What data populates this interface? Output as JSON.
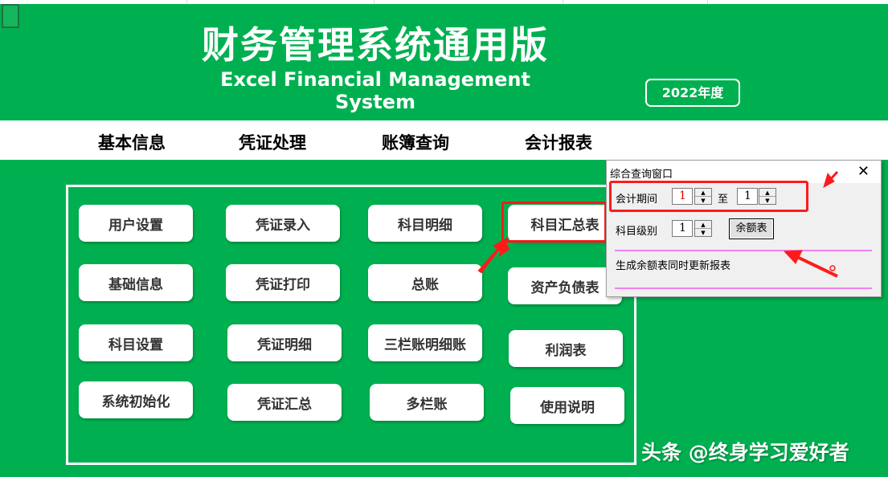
{
  "header": {
    "title_cn": "财务管理系统通用版",
    "title_en": "Excel Financial Management System",
    "year_badge": "2022年度"
  },
  "menu": {
    "items": [
      "基本信息",
      "凭证处理",
      "账簿查询",
      "会计报表"
    ]
  },
  "buttons": {
    "user_settings": "用户设置",
    "basic_info": "基础信息",
    "account_settings": "科目设置",
    "system_init": "系统初始化",
    "voucher_entry": "凭证录入",
    "voucher_print": "凭证打印",
    "voucher_detail": "凭证明细",
    "voucher_summary": "凭证汇总",
    "account_detail": "科目明细",
    "general_ledger": "总账",
    "three_column_ledger": "三栏账明细账",
    "multi_column_ledger": "多栏账",
    "account_summary": "科目汇总表",
    "balance_sheet": "资产负债表",
    "income_statement": "利润表",
    "user_manual": "使用说明"
  },
  "dialog": {
    "title": "综合查询窗口",
    "close": "✕",
    "period_label": "会计期间",
    "period_from": "1",
    "to_label": "至",
    "period_to": "1",
    "level_label": "科目级别",
    "level_value": "1",
    "balance_button": "余额表",
    "note": "生成余额表同时更新报表"
  },
  "watermark": "头条 @终身学习爱好者",
  "colors": {
    "background": "#00b050",
    "highlight": "#ff1a1a",
    "separator": "#f080f0"
  }
}
